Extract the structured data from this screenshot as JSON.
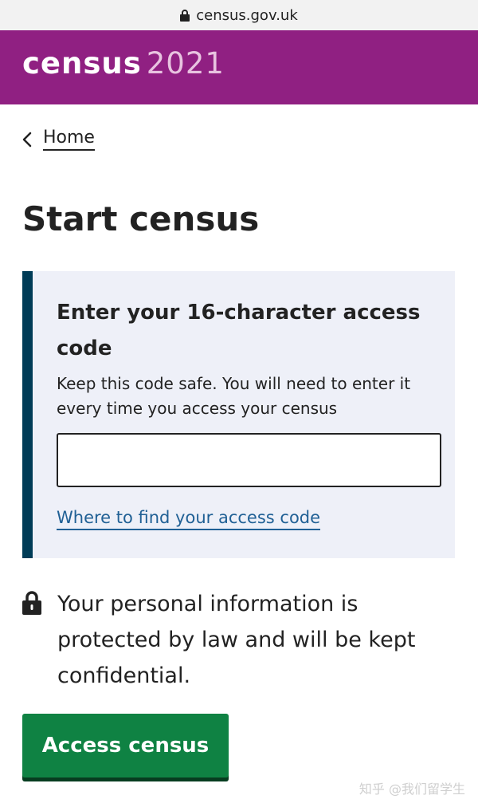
{
  "browser": {
    "url": "census.gov.uk"
  },
  "header": {
    "logo_word": "census",
    "logo_year": "2021",
    "brand_color": "#902082"
  },
  "breadcrumb": {
    "home_label": "Home"
  },
  "page": {
    "title": "Start census"
  },
  "access_code_panel": {
    "heading": "Enter your 16-character access code",
    "hint": "Keep this code safe. You will need to enter it every time you access your census",
    "input_value": "",
    "help_link": "Where to find your access code",
    "accent_color": "#003c57"
  },
  "privacy": {
    "icon": "lock-icon",
    "text": "Your personal information is protected by law and will be kept confidential."
  },
  "actions": {
    "submit_label": "Access census",
    "button_color": "#0f8243"
  },
  "watermark": {
    "text": "知乎 @我们留学生"
  }
}
